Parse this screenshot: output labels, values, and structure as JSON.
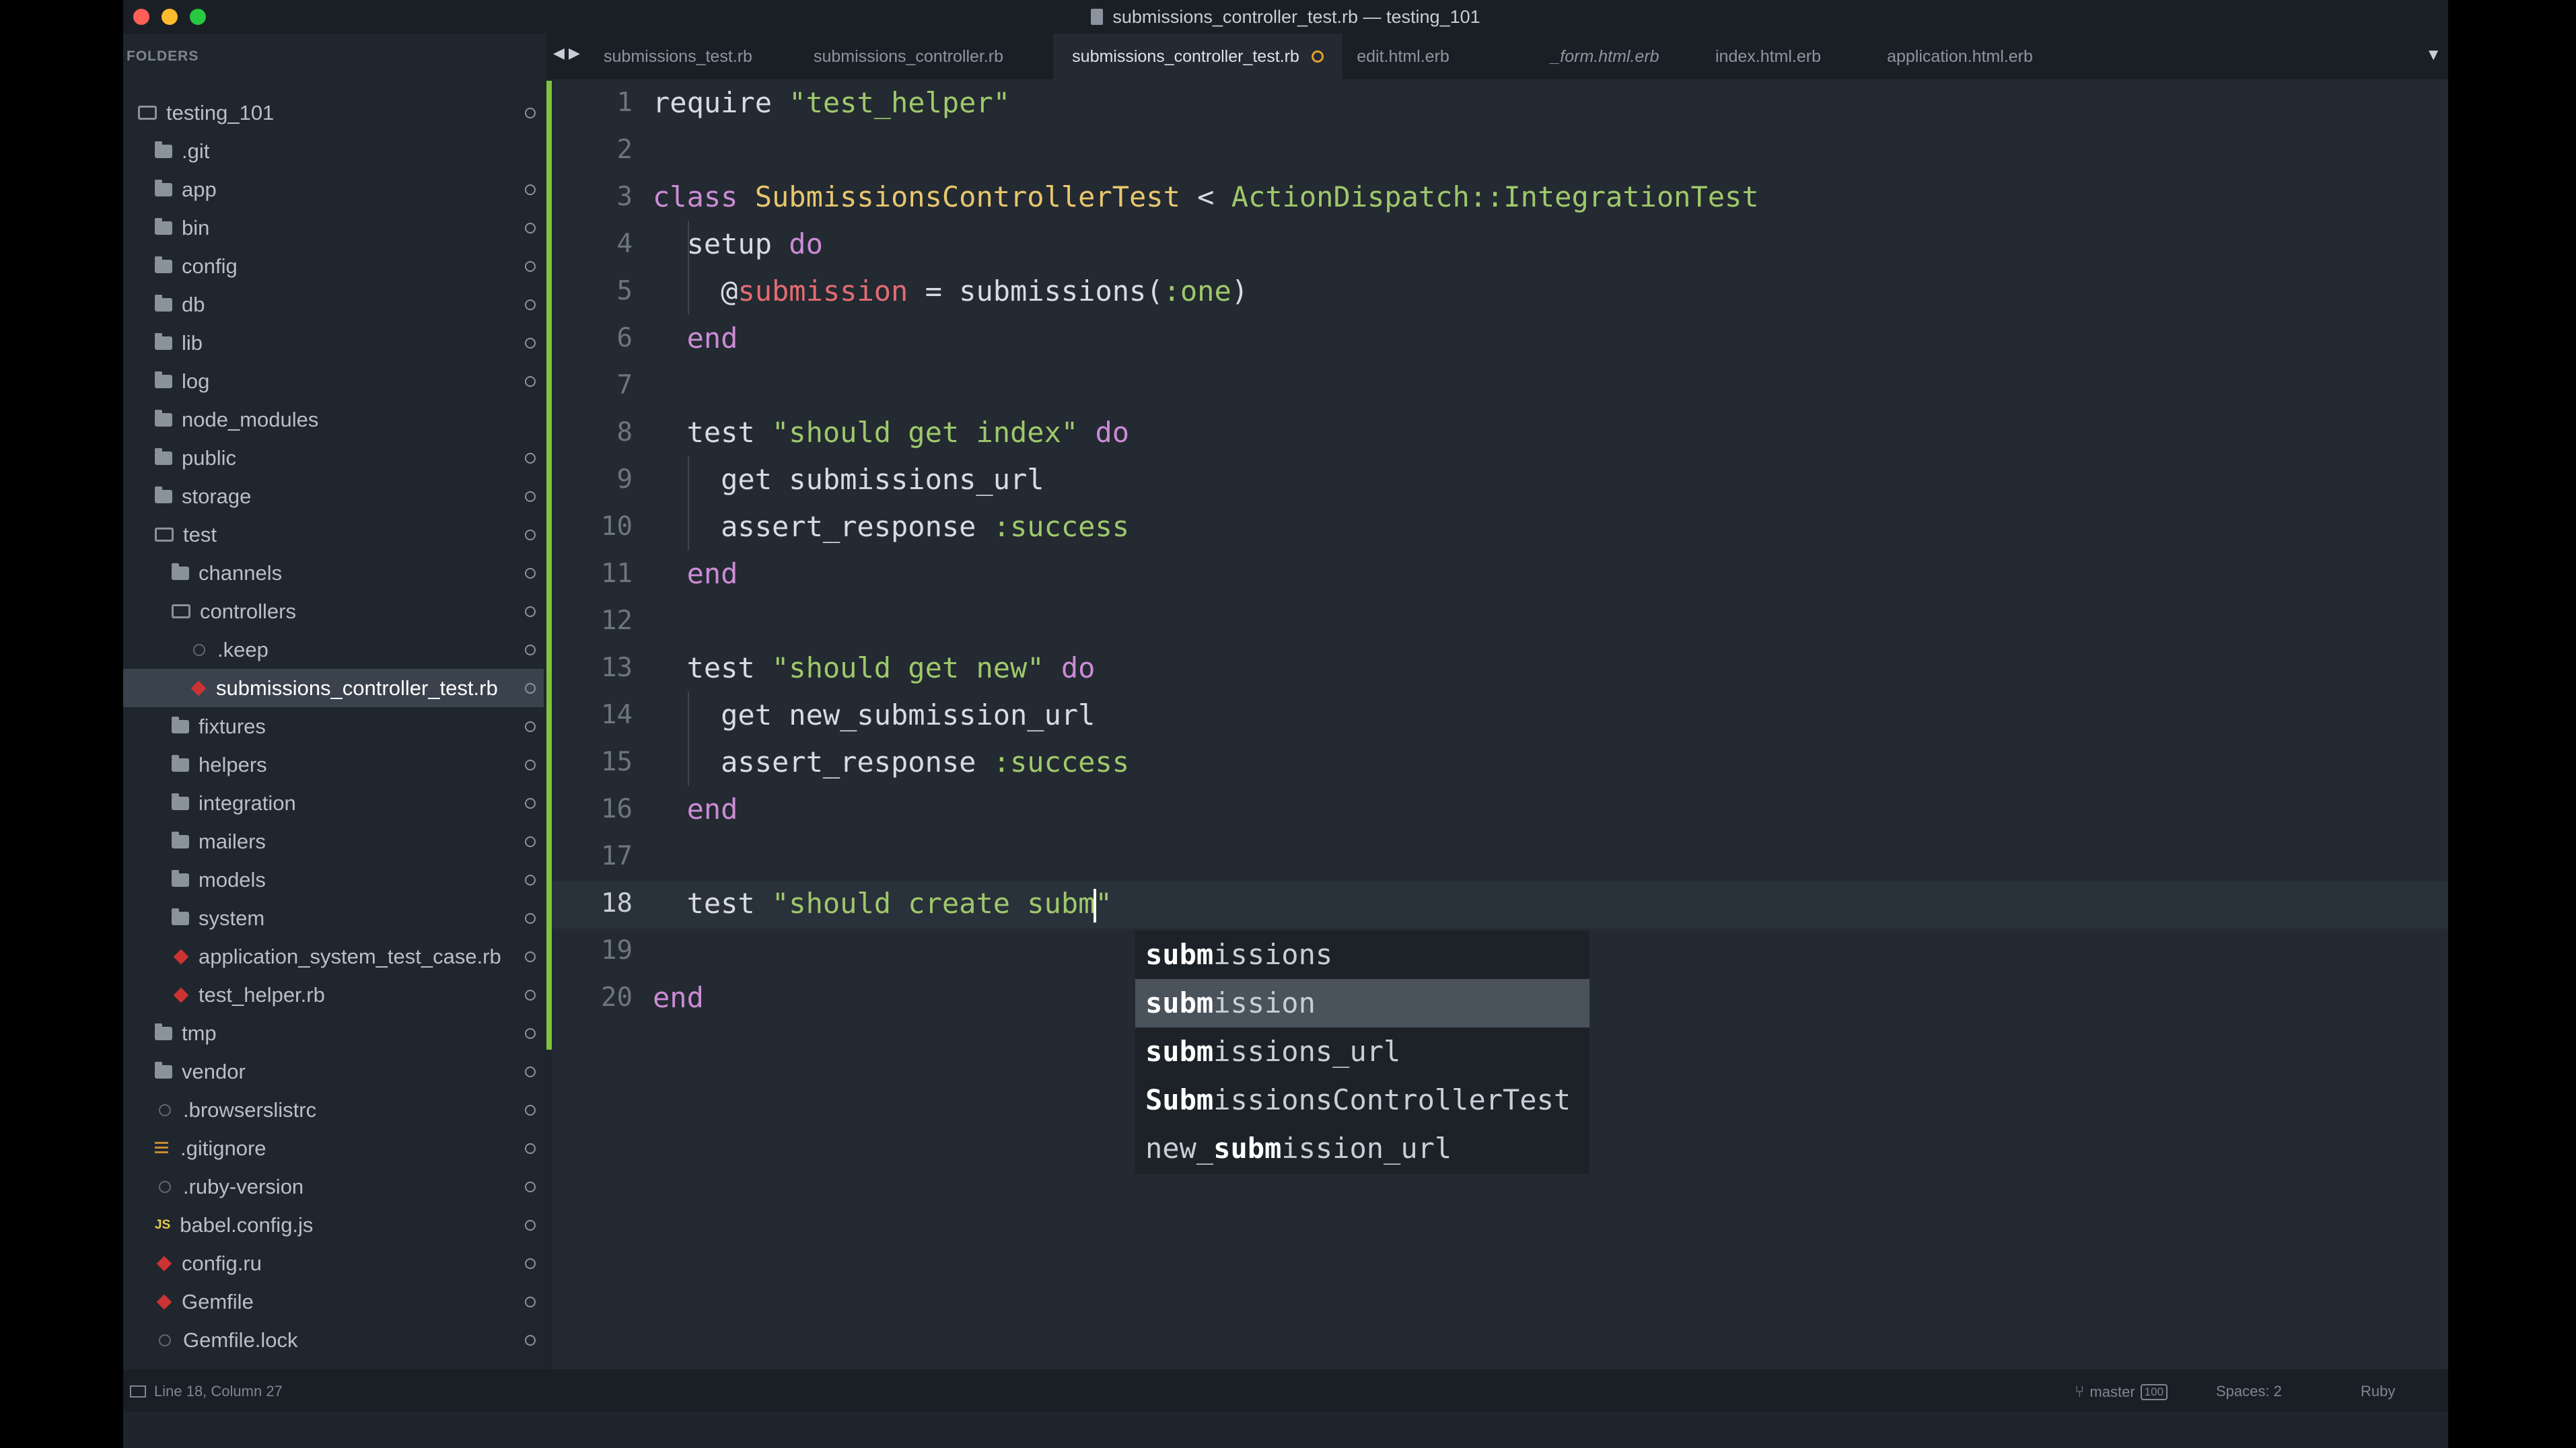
{
  "window": {
    "title": "submissions_controller_test.rb — testing_101"
  },
  "sidebar": {
    "header": "FOLDERS",
    "items": [
      {
        "label": "testing_101",
        "icon": "folder-open-icon",
        "level": 0,
        "status": true
      },
      {
        "label": ".git",
        "icon": "folder-icon",
        "level": 1,
        "status": false
      },
      {
        "label": "app",
        "icon": "folder-icon",
        "level": 1,
        "status": true
      },
      {
        "label": "bin",
        "icon": "folder-icon",
        "level": 1,
        "status": true
      },
      {
        "label": "config",
        "icon": "folder-icon",
        "level": 1,
        "status": true
      },
      {
        "label": "db",
        "icon": "folder-icon",
        "level": 1,
        "status": true
      },
      {
        "label": "lib",
        "icon": "folder-icon",
        "level": 1,
        "status": true
      },
      {
        "label": "log",
        "icon": "folder-icon",
        "level": 1,
        "status": true
      },
      {
        "label": "node_modules",
        "icon": "folder-icon",
        "level": 1,
        "status": false
      },
      {
        "label": "public",
        "icon": "folder-icon",
        "level": 1,
        "status": true
      },
      {
        "label": "storage",
        "icon": "folder-icon",
        "level": 1,
        "status": true
      },
      {
        "label": "test",
        "icon": "folder-open-icon",
        "level": 1,
        "status": true
      },
      {
        "label": "channels",
        "icon": "folder-icon",
        "level": 2,
        "status": true
      },
      {
        "label": "controllers",
        "icon": "folder-open-icon",
        "level": 2,
        "status": true
      },
      {
        "label": ".keep",
        "icon": "file-icon",
        "level": 3,
        "status": true
      },
      {
        "label": "submissions_controller_test.rb",
        "icon": "ruby-file-icon",
        "level": 3,
        "status": true,
        "active": true
      },
      {
        "label": "fixtures",
        "icon": "folder-icon",
        "level": 2,
        "status": true
      },
      {
        "label": "helpers",
        "icon": "folder-icon",
        "level": 2,
        "status": true
      },
      {
        "label": "integration",
        "icon": "folder-icon",
        "level": 2,
        "status": true
      },
      {
        "label": "mailers",
        "icon": "folder-icon",
        "level": 2,
        "status": true
      },
      {
        "label": "models",
        "icon": "folder-icon",
        "level": 2,
        "status": true
      },
      {
        "label": "system",
        "icon": "folder-icon",
        "level": 2,
        "status": true
      },
      {
        "label": "application_system_test_case.rb",
        "icon": "ruby-file-icon",
        "level": 2,
        "status": true
      },
      {
        "label": "test_helper.rb",
        "icon": "ruby-file-icon",
        "level": 2,
        "status": true
      },
      {
        "label": "tmp",
        "icon": "folder-icon",
        "level": 1,
        "status": true
      },
      {
        "label": "vendor",
        "icon": "folder-icon",
        "level": 1,
        "status": true
      },
      {
        "label": ".browserslistrc",
        "icon": "file-icon",
        "level": 1,
        "status": true
      },
      {
        "label": ".gitignore",
        "icon": "text-file-icon",
        "level": 1,
        "status": true
      },
      {
        "label": ".ruby-version",
        "icon": "file-icon",
        "level": 1,
        "status": true
      },
      {
        "label": "babel.config.js",
        "icon": "js-file-icon",
        "level": 1,
        "status": true
      },
      {
        "label": "config.ru",
        "icon": "ruby-file-icon",
        "level": 1,
        "status": true
      },
      {
        "label": "Gemfile",
        "icon": "ruby-file-icon",
        "level": 1,
        "status": true
      },
      {
        "label": "Gemfile.lock",
        "icon": "file-icon",
        "level": 1,
        "status": true
      }
    ]
  },
  "tabs": [
    {
      "label": "submissions_test.rb",
      "active": false,
      "italic": false
    },
    {
      "label": "submissions_controller.rb",
      "active": false,
      "italic": false
    },
    {
      "label": "submissions_controller_test.rb",
      "active": true,
      "italic": false,
      "dirty": true
    },
    {
      "label": "edit.html.erb",
      "active": false,
      "italic": false
    },
    {
      "label": "_form.html.erb",
      "active": false,
      "italic": true
    },
    {
      "label": "index.html.erb",
      "active": false,
      "italic": false
    },
    {
      "label": "application.html.erb",
      "active": false,
      "italic": false
    }
  ],
  "editor": {
    "current_line": 18,
    "lines": [
      [
        [
          "kw0",
          "require "
        ],
        [
          "str",
          "\"test_helper\""
        ]
      ],
      [],
      [
        [
          "kw",
          "class "
        ],
        [
          "cls",
          "SubmissionsControllerTest"
        ],
        [
          "txt",
          " < "
        ],
        [
          "cls2",
          "ActionDispatch::IntegrationTest"
        ]
      ],
      [
        [
          "txt",
          "  setup "
        ],
        [
          "kw",
          "do"
        ]
      ],
      [
        [
          "txt",
          "    @"
        ],
        [
          "ivar",
          "submission"
        ],
        [
          "txt",
          " = submissions("
        ],
        [
          "sym",
          ":one"
        ],
        [
          "txt",
          ")"
        ]
      ],
      [
        [
          "kw",
          "  end"
        ]
      ],
      [],
      [
        [
          "txt",
          "  test "
        ],
        [
          "str",
          "\"should get index\""
        ],
        [
          "txt",
          " "
        ],
        [
          "kw",
          "do"
        ]
      ],
      [
        [
          "txt",
          "    get submissions_url"
        ]
      ],
      [
        [
          "txt",
          "    assert_response "
        ],
        [
          "sym",
          ":success"
        ]
      ],
      [
        [
          "kw",
          "  end"
        ]
      ],
      [],
      [
        [
          "txt",
          "  test "
        ],
        [
          "str",
          "\"should get new\""
        ],
        [
          "txt",
          " "
        ],
        [
          "kw",
          "do"
        ]
      ],
      [
        [
          "txt",
          "    get new_submission_url"
        ]
      ],
      [
        [
          "txt",
          "    assert_response "
        ],
        [
          "sym",
          ":success"
        ]
      ],
      [
        [
          "kw",
          "  end"
        ]
      ],
      [],
      [
        [
          "txt",
          "  test "
        ],
        [
          "str",
          "\"should create subm"
        ],
        [
          "cursor",
          ""
        ],
        [
          "str",
          "\""
        ]
      ],
      [],
      [
        [
          "kw",
          "end"
        ]
      ]
    ]
  },
  "autocomplete": {
    "selected_index": 1,
    "items": [
      {
        "pre": "",
        "match": "subm",
        "post": "issions"
      },
      {
        "pre": "",
        "match": "subm",
        "post": "ission"
      },
      {
        "pre": "",
        "match": "subm",
        "post": "issions_url"
      },
      {
        "pre": "",
        "match": "Subm",
        "post": "issionsControllerTest"
      },
      {
        "pre": "new_",
        "match": "subm",
        "post": "ission_url"
      }
    ]
  },
  "statusbar": {
    "position": "Line 18, Column 27",
    "branch": "master",
    "branch_count": "100",
    "spaces": "Spaces: 2",
    "syntax": "Ruby"
  }
}
